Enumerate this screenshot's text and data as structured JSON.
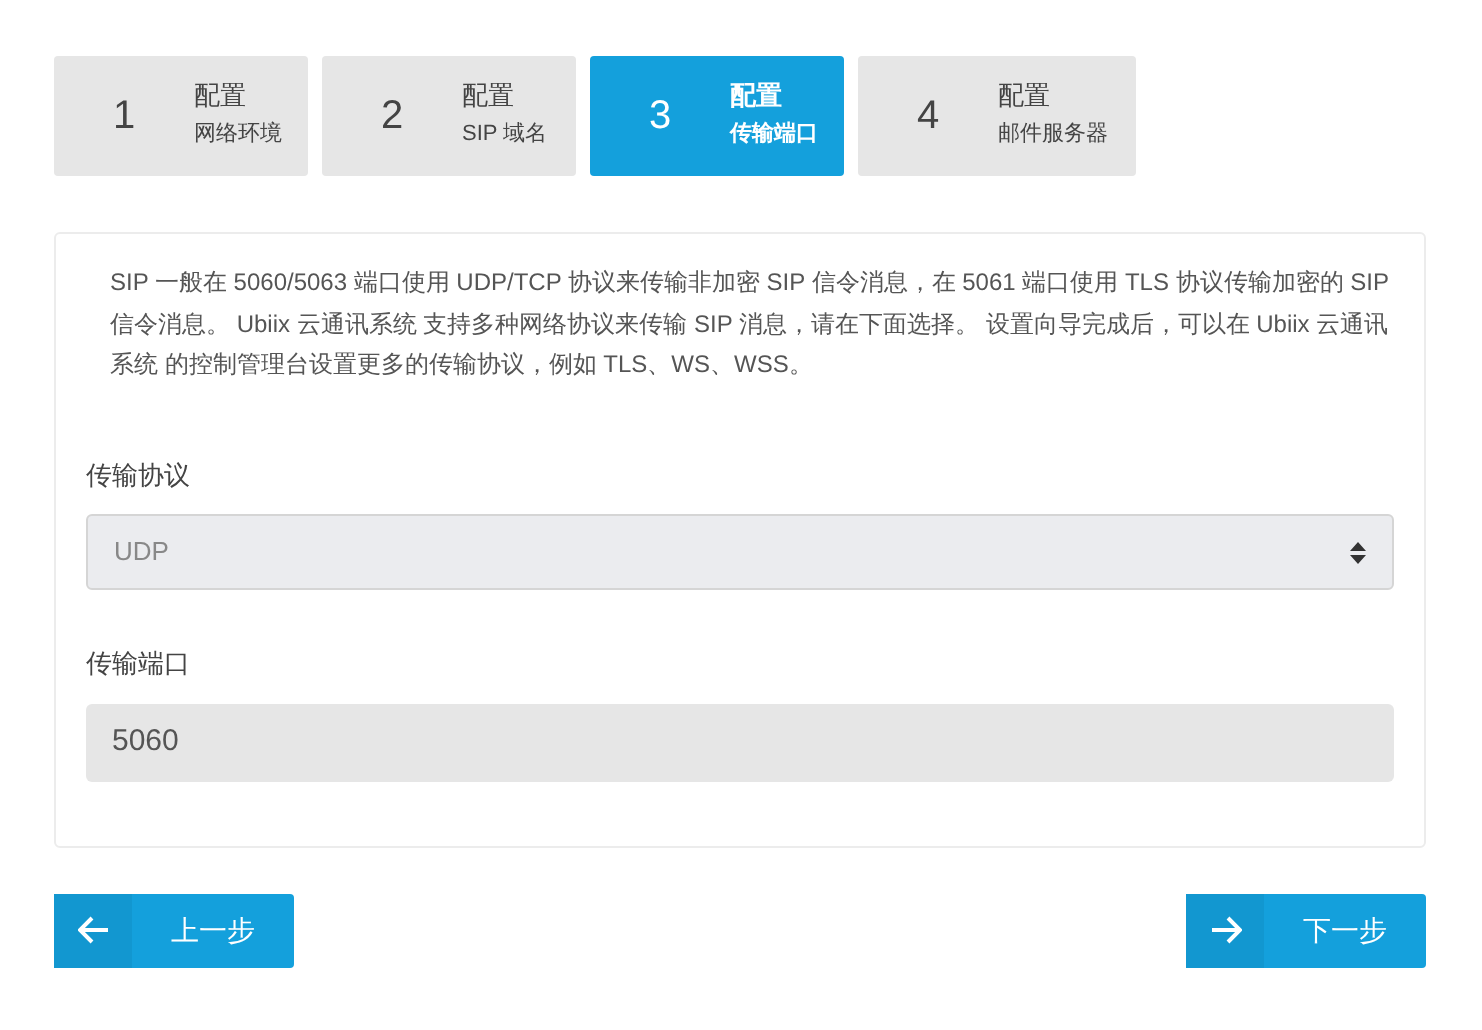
{
  "steps": [
    {
      "number": "1",
      "title": "配置",
      "subtitle": "网络环境",
      "selected": false
    },
    {
      "number": "2",
      "title": "配置",
      "subtitle": "SIP 域名",
      "selected": false
    },
    {
      "number": "3",
      "title": "配置",
      "subtitle": "传输端口",
      "selected": true
    },
    {
      "number": "4",
      "title": "配置",
      "subtitle": "邮件服务器",
      "selected": false
    }
  ],
  "description": "SIP 一般在 5060/5063 端口使用 UDP/TCP 协议来传输非加密 SIP 信令消息，在 5061 端口使用 TLS 协议传输加密的 SIP 信令消息。 Ubiix 云通讯系统 支持多种网络协议来传输 SIP 消息，请在下面选择。 设置向导完成后，可以在 Ubiix 云通讯系统 的控制管理台设置更多的传输协议，例如 TLS、WS、WSS。",
  "transport_protocol": {
    "label": "传输协议",
    "value": "UDP"
  },
  "transport_port": {
    "label": "传输端口",
    "value": "5060"
  },
  "buttons": {
    "previous": "上一步",
    "next": "下一步"
  }
}
